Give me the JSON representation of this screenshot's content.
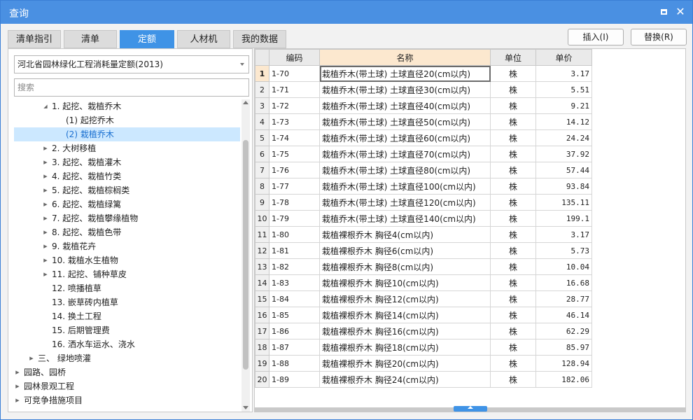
{
  "window": {
    "title": "查询",
    "maximize_icon": "maximize-icon",
    "close_icon": "close-icon",
    "close_glyph": "✕"
  },
  "tabs": [
    {
      "label": "清单指引",
      "active": false
    },
    {
      "label": "清单",
      "active": false
    },
    {
      "label": "定额",
      "active": true
    },
    {
      "label": "人材机",
      "active": false
    },
    {
      "label": "我的数据",
      "active": false
    }
  ],
  "actions": {
    "insert": "插入(I)",
    "replace": "替换(R)"
  },
  "left": {
    "combo_value": "河北省园林绿化工程消耗量定额(2013)",
    "search_placeholder": "搜索",
    "tree": [
      {
        "label": "1. 起挖、栽植乔木",
        "level": 2,
        "arrow": "expanded"
      },
      {
        "label": "(1) 起挖乔木",
        "level": 3,
        "arrow": "none"
      },
      {
        "label": "(2) 栽植乔木",
        "level": 3,
        "arrow": "none",
        "selected": true
      },
      {
        "label": "2. 大树移植",
        "level": 2,
        "arrow": "collapsed"
      },
      {
        "label": "3. 起挖、栽植灌木",
        "level": 2,
        "arrow": "collapsed"
      },
      {
        "label": "4. 起挖、栽植竹类",
        "level": 2,
        "arrow": "collapsed"
      },
      {
        "label": "5. 起挖、栽植棕榈类",
        "level": 2,
        "arrow": "collapsed"
      },
      {
        "label": "6. 起挖、栽植绿篱",
        "level": 2,
        "arrow": "collapsed"
      },
      {
        "label": "7. 起挖、栽植攀缘植物",
        "level": 2,
        "arrow": "collapsed"
      },
      {
        "label": "8. 起挖、栽植色带",
        "level": 2,
        "arrow": "collapsed"
      },
      {
        "label": "9. 栽植花卉",
        "level": 2,
        "arrow": "collapsed"
      },
      {
        "label": "10. 栽植水生植物",
        "level": 2,
        "arrow": "collapsed"
      },
      {
        "label": "11. 起挖、铺种草皮",
        "level": 2,
        "arrow": "collapsed"
      },
      {
        "label": "12. 喷播植草",
        "level": 2,
        "arrow": "none"
      },
      {
        "label": "13. 嵌草砖内植草",
        "level": 2,
        "arrow": "none"
      },
      {
        "label": "14. 换土工程",
        "level": 2,
        "arrow": "none"
      },
      {
        "label": "15. 后期管理费",
        "level": 2,
        "arrow": "none"
      },
      {
        "label": "16. 洒水车运水、浇水",
        "level": 2,
        "arrow": "none"
      },
      {
        "label": "三、 绿地喷灌",
        "level": 1,
        "arrow": "collapsed"
      },
      {
        "label": "园路、园桥",
        "level": 0,
        "arrow": "collapsed"
      },
      {
        "label": "园林景观工程",
        "level": 0,
        "arrow": "collapsed"
      },
      {
        "label": "可竞争措施项目",
        "level": 0,
        "arrow": "collapsed"
      }
    ]
  },
  "grid": {
    "headers": [
      "",
      "编码",
      "名称",
      "单位",
      "单价"
    ],
    "rows": [
      {
        "no": "1",
        "code": "1-70",
        "name": "栽植乔木(带土球) 土球直径20(cm以内)",
        "unit": "株",
        "price": "3.17"
      },
      {
        "no": "2",
        "code": "1-71",
        "name": "栽植乔木(带土球) 土球直径30(cm以内)",
        "unit": "株",
        "price": "5.51"
      },
      {
        "no": "3",
        "code": "1-72",
        "name": "栽植乔木(带土球) 土球直径40(cm以内)",
        "unit": "株",
        "price": "9.21"
      },
      {
        "no": "4",
        "code": "1-73",
        "name": "栽植乔木(带土球) 土球直径50(cm以内)",
        "unit": "株",
        "price": "14.12"
      },
      {
        "no": "5",
        "code": "1-74",
        "name": "栽植乔木(带土球) 土球直径60(cm以内)",
        "unit": "株",
        "price": "24.24"
      },
      {
        "no": "6",
        "code": "1-75",
        "name": "栽植乔木(带土球) 土球直径70(cm以内)",
        "unit": "株",
        "price": "37.92"
      },
      {
        "no": "7",
        "code": "1-76",
        "name": "栽植乔木(带土球) 土球直径80(cm以内)",
        "unit": "株",
        "price": "57.44"
      },
      {
        "no": "8",
        "code": "1-77",
        "name": "栽植乔木(带土球) 土球直径100(cm以内)",
        "unit": "株",
        "price": "93.84"
      },
      {
        "no": "9",
        "code": "1-78",
        "name": "栽植乔木(带土球) 土球直径120(cm以内)",
        "unit": "株",
        "price": "135.11"
      },
      {
        "no": "10",
        "code": "1-79",
        "name": "栽植乔木(带土球) 土球直径140(cm以内)",
        "unit": "株",
        "price": "199.1"
      },
      {
        "no": "11",
        "code": "1-80",
        "name": "栽植裸根乔木 胸径4(cm以内)",
        "unit": "株",
        "price": "3.17"
      },
      {
        "no": "12",
        "code": "1-81",
        "name": "栽植裸根乔木 胸径6(cm以内)",
        "unit": "株",
        "price": "5.73"
      },
      {
        "no": "13",
        "code": "1-82",
        "name": "栽植裸根乔木 胸径8(cm以内)",
        "unit": "株",
        "price": "10.04"
      },
      {
        "no": "14",
        "code": "1-83",
        "name": "栽植裸根乔木 胸径10(cm以内)",
        "unit": "株",
        "price": "16.68"
      },
      {
        "no": "15",
        "code": "1-84",
        "name": "栽植裸根乔木 胸径12(cm以内)",
        "unit": "株",
        "price": "28.77"
      },
      {
        "no": "16",
        "code": "1-85",
        "name": "栽植裸根乔木 胸径14(cm以内)",
        "unit": "株",
        "price": "46.14"
      },
      {
        "no": "17",
        "code": "1-86",
        "name": "栽植裸根乔木 胸径16(cm以内)",
        "unit": "株",
        "price": "62.29"
      },
      {
        "no": "18",
        "code": "1-87",
        "name": "栽植裸根乔木 胸径18(cm以内)",
        "unit": "株",
        "price": "85.97"
      },
      {
        "no": "19",
        "code": "1-88",
        "name": "栽植裸根乔木 胸径20(cm以内)",
        "unit": "株",
        "price": "128.94"
      },
      {
        "no": "20",
        "code": "1-89",
        "name": "栽植裸根乔木 胸径24(cm以内)",
        "unit": "株",
        "price": "182.06"
      }
    ]
  },
  "colors": {
    "titlebar": "#4a90e2",
    "tab_active": "#3f93e6",
    "selection": "#cce8ff",
    "header_highlight": "#fce8cf"
  }
}
